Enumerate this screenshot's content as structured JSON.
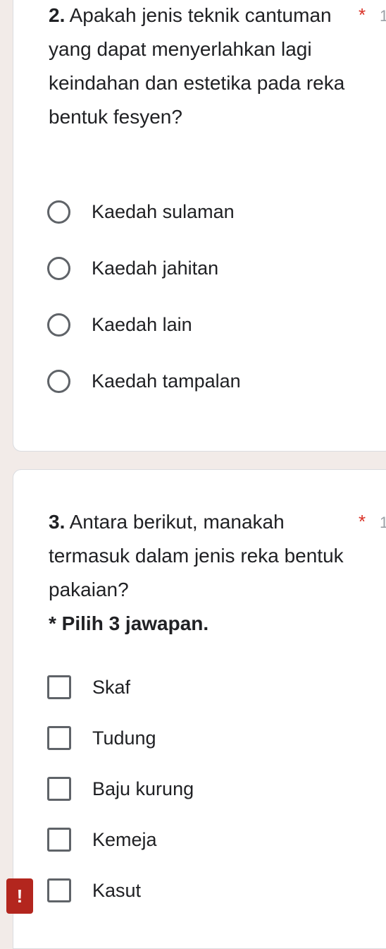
{
  "question2": {
    "number": "2.",
    "title": "Apakah jenis teknik cantuman yang dapat menyerlahkan lagi keindahan dan estetika pada reka bentuk fesyen?",
    "required_mark": "*",
    "options": [
      "Kaedah sulaman",
      "Kaedah jahitan",
      "Kaedah lain",
      "Kaedah tampalan"
    ]
  },
  "question3": {
    "number": "3.",
    "title": "Antara berikut, manakah termasuk dalam jenis reka bentuk pakaian?",
    "required_mark": "*",
    "note": "* Pilih 3 jawapan.",
    "options": [
      "Skaf",
      "Tudung",
      "Baju kurung",
      "Kemeja",
      "Kasut"
    ]
  },
  "cut_off_char": "1",
  "warning_badge": "!",
  "colors": {
    "accent_required": "#d93025",
    "warning": "#b3261e",
    "page_bg": "#f2ebe8"
  }
}
